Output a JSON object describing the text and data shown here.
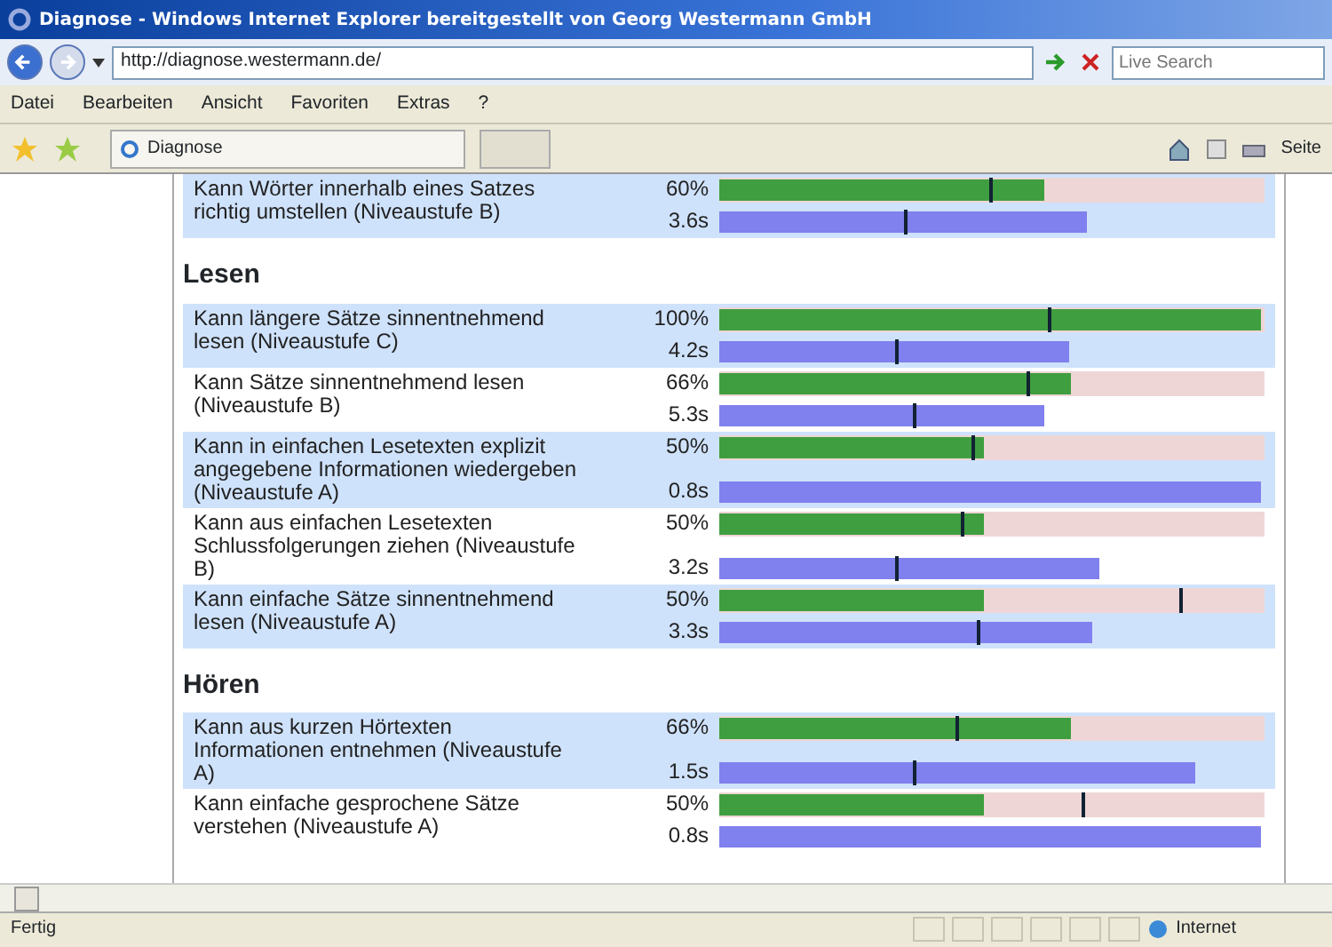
{
  "window": {
    "title": "Diagnose - Windows Internet Explorer bereitgestellt von Georg Westermann GmbH"
  },
  "address_bar": {
    "url": "http://diagnose.westermann.de/",
    "search_placeholder": "Live Search"
  },
  "menu": [
    "Datei",
    "Bearbeiten",
    "Ansicht",
    "Favoriten",
    "Extras",
    "?"
  ],
  "tab": {
    "label": "Diagnose"
  },
  "command_bar": {
    "page_menu": "Seite"
  },
  "sections": [
    {
      "rows": [
        {
          "label": "Kann Wörter innerhalb eines Satzes richtig umstellen (Niveaustufe B)",
          "shaded": true,
          "score": {
            "text": "60%",
            "level": 0.6,
            "average": {
              "level": 0.5
            }
          },
          "time": {
            "text": "3.6s",
            "level": 0.68,
            "average": {
              "level": 0.345
            }
          }
        }
      ]
    },
    {
      "heading": "Lesen",
      "rows": [
        {
          "label": "Kann längere Sätze sinnentnehmend lesen (Niveaustufe C)",
          "shaded": true,
          "score": {
            "text": "100%",
            "level": 1.0,
            "average": {
              "level": 0.61
            }
          },
          "time": {
            "text": "4.2s",
            "level": 0.645,
            "average": {
              "level": 0.33
            }
          }
        },
        {
          "label": "Kann Sätze sinnentnehmend lesen (Niveaustufe B)",
          "shaded": false,
          "score": {
            "text": "66%",
            "level": 0.65,
            "average": {
              "level": 0.57
            }
          },
          "time": {
            "text": "5.3s",
            "level": 0.6,
            "average": {
              "level": 0.36
            }
          }
        },
        {
          "label": "Kann in einfachen Lesetexten explizit angegebene Informationen wiedergeben (Niveaustufe A)",
          "shaded": true,
          "score": {
            "text": "50%",
            "level": 0.49,
            "average": {
              "level": 0.47
            }
          },
          "time": {
            "text": "0.8s",
            "level": 1.0
          }
        },
        {
          "label": "Kann aus einfachen Lesetexten Schlussfolgerungen ziehen (Niveaustufe B)",
          "shaded": false,
          "score": {
            "text": "50%",
            "level": 0.49,
            "average": {
              "level": 0.45
            }
          },
          "time": {
            "text": "3.2s",
            "level": 0.7,
            "average": {
              "level": 0.33
            }
          }
        },
        {
          "label": "Kann einfache Sätze sinnentnehmend lesen (Niveaustufe A)",
          "shaded": true,
          "score": {
            "text": "50%",
            "level": 0.49,
            "average": {
              "level": 0.85
            }
          },
          "time": {
            "text": "3.3s",
            "level": 0.69,
            "average": {
              "level": 0.48
            }
          }
        }
      ]
    },
    {
      "heading": "Hören",
      "rows": [
        {
          "label": "Kann aus kurzen Hörtexten Informationen entnehmen (Niveaustufe A)",
          "shaded": true,
          "score": {
            "text": "66%",
            "level": 0.65,
            "average": {
              "level": 0.44
            }
          },
          "time": {
            "text": "1.5s",
            "level": 0.88,
            "average": {
              "level": 0.36
            }
          }
        },
        {
          "label": "Kann einfache gesprochene Sätze verstehen (Niveaustufe A)",
          "shaded": false,
          "score": {
            "text": "50%",
            "level": 0.49,
            "average": {
              "level": 0.67
            }
          },
          "time": {
            "text": "0.8s",
            "level": 1.0
          }
        }
      ]
    }
  ],
  "status_bar": {
    "text": "Fertig",
    "zone": "Internet"
  }
}
